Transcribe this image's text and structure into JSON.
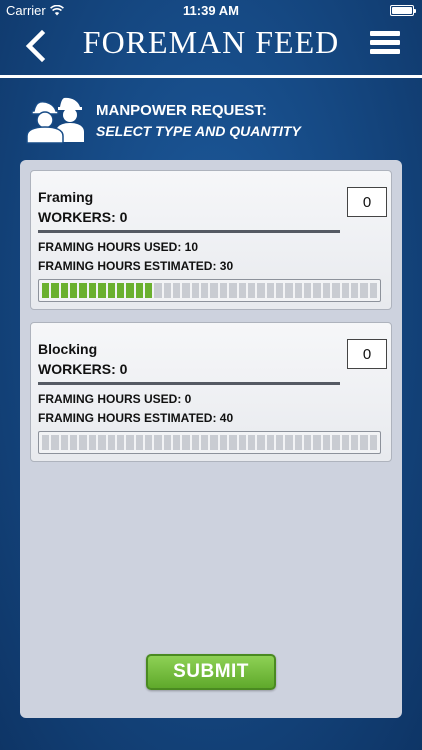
{
  "status_bar": {
    "carrier": "Carrier",
    "time": "11:39 AM",
    "icons": [
      "wifi-icon",
      "battery-icon"
    ]
  },
  "nav": {
    "title": "FOREMAN FEED",
    "back_icon": "chevron-left-icon",
    "menu_icon": "hamburger-menu-icon"
  },
  "header": {
    "icon": "construction-workers-icon",
    "title": "MANPOWER REQUEST:",
    "subtitle": "SELECT TYPE AND QUANTITY"
  },
  "cards": [
    {
      "name": "Framing",
      "workers": "WORKERS: 0",
      "quantity": "0",
      "hours_used": "FRAMING HOURS USED: 10",
      "hours_estimated": "FRAMING HOURS ESTIMATED: 30",
      "progress_fraction": 0.333
    },
    {
      "name": "Blocking",
      "workers": "WORKERS: 0",
      "quantity": "0",
      "hours_used": "FRAMING HOURS USED: 0",
      "hours_estimated": "FRAMING HOURS ESTIMATED: 40",
      "progress_fraction": 0
    }
  ],
  "submit_label": "SUBMIT",
  "colors": {
    "background": "#164a85",
    "panel": "#cdd2de",
    "progress_fill": "#6ab02e",
    "submit": "#6ab02e"
  }
}
